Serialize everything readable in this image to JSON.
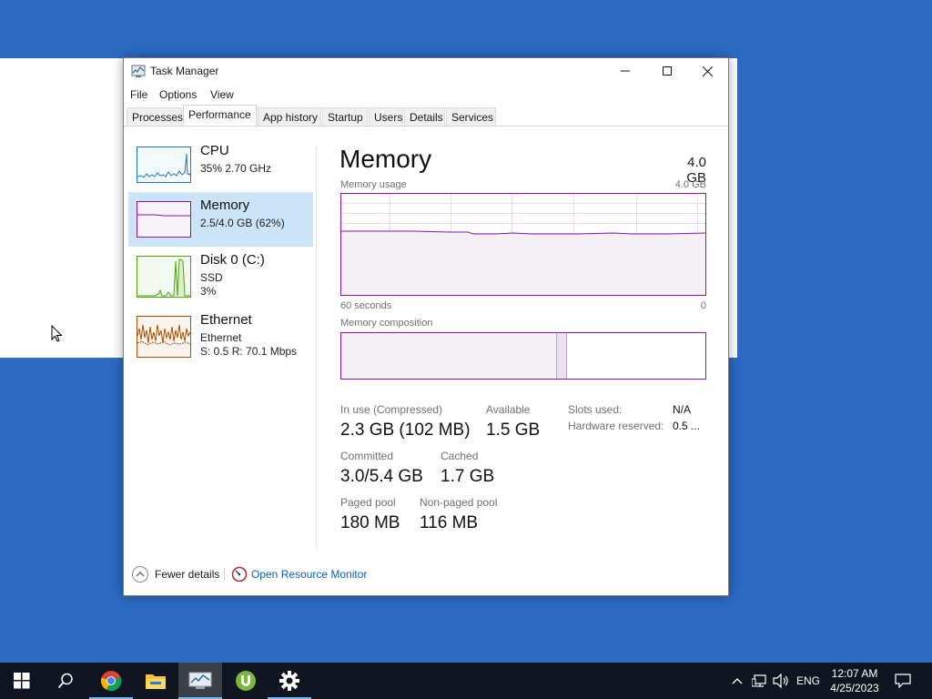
{
  "window": {
    "title": "Task Manager"
  },
  "menu": [
    "File",
    "Options",
    "View"
  ],
  "tabs": [
    {
      "label": "Processes"
    },
    {
      "label": "Performance"
    },
    {
      "label": "App history"
    },
    {
      "label": "Startup"
    },
    {
      "label": "Users"
    },
    {
      "label": "Details"
    },
    {
      "label": "Services"
    }
  ],
  "active_tab": "Performance",
  "sidebar": [
    {
      "title": "CPU",
      "line1": "35%  2.70 GHz",
      "line2": ""
    },
    {
      "title": "Memory",
      "line1": "2.5/4.0 GB (62%)",
      "line2": ""
    },
    {
      "title": "Disk 0 (C:)",
      "line1": "SSD",
      "line2": "3%"
    },
    {
      "title": "Ethernet",
      "line1": "Ethernet",
      "line2": "S: 0.5  R: 70.1 Mbps"
    }
  ],
  "selected_resource": "Memory",
  "main": {
    "title": "Memory",
    "total": "4.0 GB",
    "usage_label": "Memory usage",
    "usage_max": "4.0 GB",
    "time_label": "60 seconds",
    "time_min": "0",
    "composition_label": "Memory composition",
    "usage_level_fraction": 0.62,
    "stats": {
      "in_use_label": "In use (Compressed)",
      "in_use_value": "2.3 GB (102 MB)",
      "available_label": "Available",
      "available_value": "1.5 GB",
      "committed_label": "Committed",
      "committed_value": "3.0/5.4 GB",
      "cached_label": "Cached",
      "cached_value": "1.7 GB",
      "paged_label": "Paged pool",
      "paged_value": "180 MB",
      "nonpaged_label": "Non-paged pool",
      "nonpaged_value": "116 MB",
      "slots_label": "Slots used:",
      "slots_value": "N/A",
      "hw_reserved_label": "Hardware reserved:",
      "hw_reserved_value": "0.5 ..."
    }
  },
  "footer": {
    "fewer_details": "Fewer details",
    "open_resource_monitor": "Open Resource Monitor"
  },
  "taskbar": {
    "apps": [
      "start-icon",
      "search-icon",
      "chrome-icon",
      "file-explorer-icon",
      "task-manager-icon",
      "utorrent-icon",
      "settings-icon"
    ],
    "language": "ENG",
    "time": "12:07 AM",
    "date": "4/25/2023"
  },
  "colors": {
    "desktop": "#2d6ac4",
    "memory_accent": "#8b12ae",
    "cpu_accent": "#1a79b6",
    "disk_accent": "#4da60c",
    "ethernet_accent": "#a74f01",
    "selected_item": "#cce4f7",
    "link": "#0a5fb4",
    "taskbar": "#101621"
  }
}
